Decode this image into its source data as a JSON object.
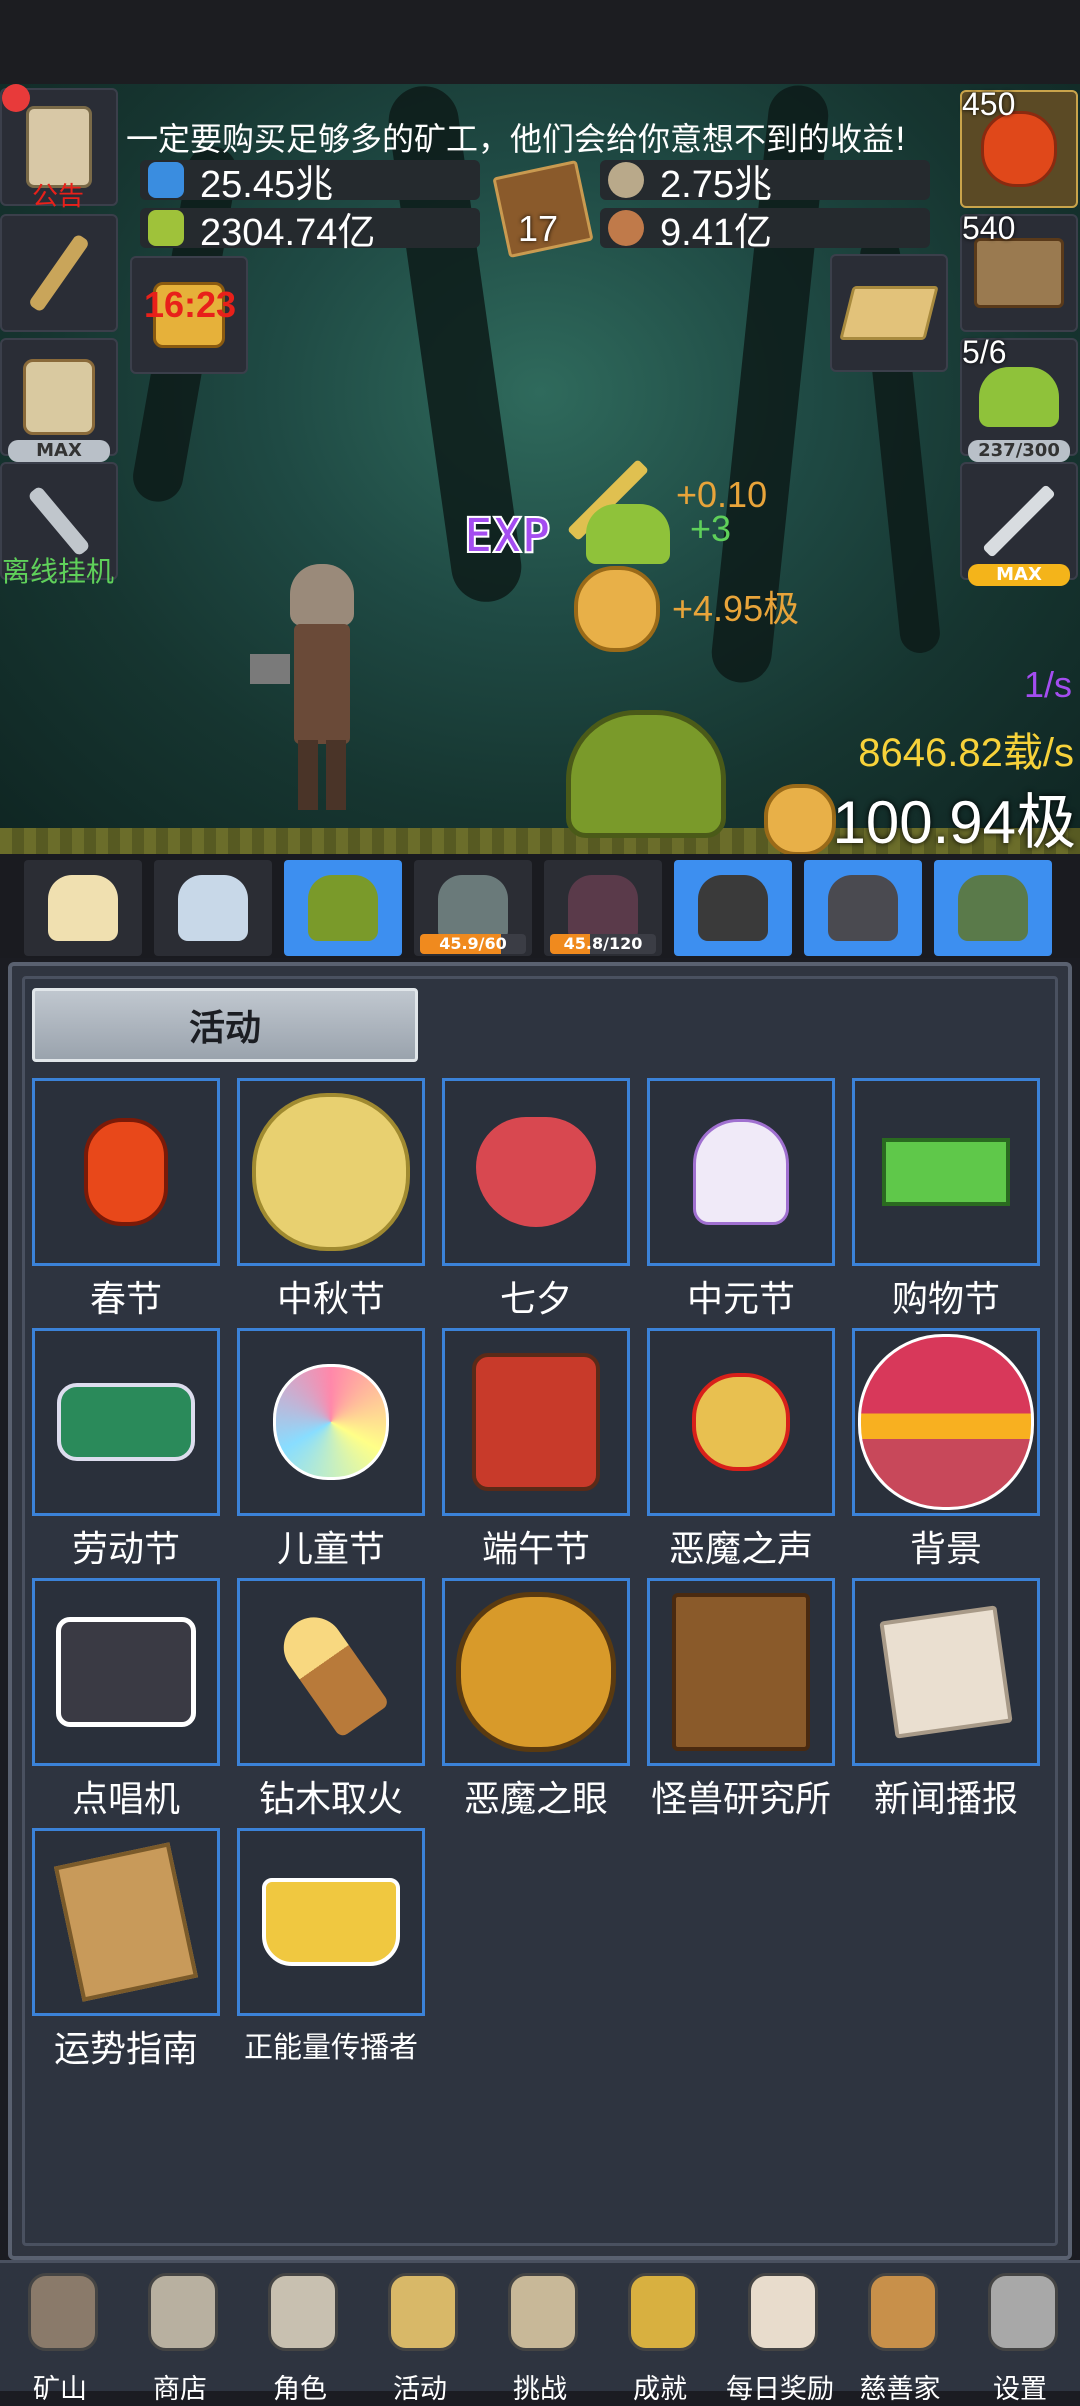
{
  "top": {
    "notice": "一定要购买足够多的矿工，他们会给你意想不到的收益!",
    "resources": [
      {
        "value": "25.45兆",
        "icon": "blue-potion-icon"
      },
      {
        "value": "2304.74亿",
        "icon": "green-potion-icon"
      },
      {
        "value": "2.75兆",
        "icon": "stone-icon"
      },
      {
        "value": "9.41亿",
        "icon": "meat-icon"
      }
    ],
    "book_count": "17",
    "timer": "16:23"
  },
  "left_slots": {
    "announce_label": "公告",
    "mug_badge": "MAX",
    "offline_label": "离线挂机"
  },
  "right_slots": {
    "potion_count": "450",
    "chest_count": "540",
    "slime_count": "5/6",
    "slime_badge": "237/300",
    "sword_badge": "MAX"
  },
  "battle": {
    "exp_text": "EXP",
    "plus_sword": "+0.10",
    "plus_slime": "+3",
    "plus_coin": "+4.95极",
    "rate_per_sec": "1/s",
    "income_per_sec": "8646.82载/s",
    "gold_total": "100.94极"
  },
  "monsters": [
    {
      "icon": "candle-icon",
      "bg": "dark",
      "progress_text": "",
      "progress": 0
    },
    {
      "icon": "egg-icon",
      "bg": "dark",
      "progress_text": "",
      "progress": 0
    },
    {
      "icon": "slime-icon",
      "bg": "blue",
      "progress_text": "",
      "progress": 0
    },
    {
      "icon": "zombie-icon",
      "bg": "dark",
      "progress_text": "45.9/60",
      "progress": 0.765
    },
    {
      "icon": "demon-icon",
      "bg": "dark",
      "progress_text": "45.8/120",
      "progress": 0.38
    },
    {
      "icon": "spider-icon",
      "bg": "blue",
      "progress_text": "",
      "progress": 0
    },
    {
      "icon": "ghoul-icon",
      "bg": "blue",
      "progress_text": "",
      "progress": 0
    },
    {
      "icon": "orc-icon",
      "bg": "blue",
      "progress_text": "",
      "progress": 0
    }
  ],
  "panel": {
    "title": "活动",
    "items": [
      {
        "label": "春节",
        "icon": "lantern-icon"
      },
      {
        "label": "中秋节",
        "icon": "moon-icon"
      },
      {
        "label": "七夕",
        "icon": "heart-icon"
      },
      {
        "label": "中元节",
        "icon": "ghost-icon"
      },
      {
        "label": "购物节",
        "icon": "money-icon"
      },
      {
        "label": "劳动节",
        "icon": "brush-icon"
      },
      {
        "label": "儿童节",
        "icon": "lollipop-icon"
      },
      {
        "label": "端午节",
        "icon": "dragon-mask-icon"
      },
      {
        "label": "恶魔之声",
        "icon": "bell-icon"
      },
      {
        "label": "背景",
        "icon": "sunset-icon"
      },
      {
        "label": "点唱机",
        "icon": "cassette-icon"
      },
      {
        "label": "钻木取火",
        "icon": "torch-icon"
      },
      {
        "label": "恶魔之眼",
        "icon": "eye-icon"
      },
      {
        "label": "怪兽研究所",
        "icon": "lab-icon"
      },
      {
        "label": "新闻播报",
        "icon": "newspaper-icon"
      },
      {
        "label": "运势指南",
        "icon": "fortune-map-icon"
      },
      {
        "label": "正能量传播者",
        "icon": "crown-icon"
      }
    ]
  },
  "nav": [
    {
      "label": "矿山",
      "icon": "lantern-nav-icon"
    },
    {
      "label": "商店",
      "icon": "ore-icon"
    },
    {
      "label": "角色",
      "icon": "skull-icon"
    },
    {
      "label": "活动",
      "icon": "scroll-icon"
    },
    {
      "label": "挑战",
      "icon": "map-icon"
    },
    {
      "label": "成就",
      "icon": "key-icon"
    },
    {
      "label": "每日奖励",
      "icon": "letter-icon"
    },
    {
      "label": "慈善家",
      "icon": "bread-icon"
    },
    {
      "label": "设置",
      "icon": "gear-icon"
    }
  ],
  "colors": {
    "accent_blue": "#3b82d8",
    "gold_text": "#f7d23a",
    "plus_orange": "#e8a43a",
    "plus_green": "#5fd05a",
    "purple": "#a44df0",
    "panel_bg": "#2e3440"
  }
}
